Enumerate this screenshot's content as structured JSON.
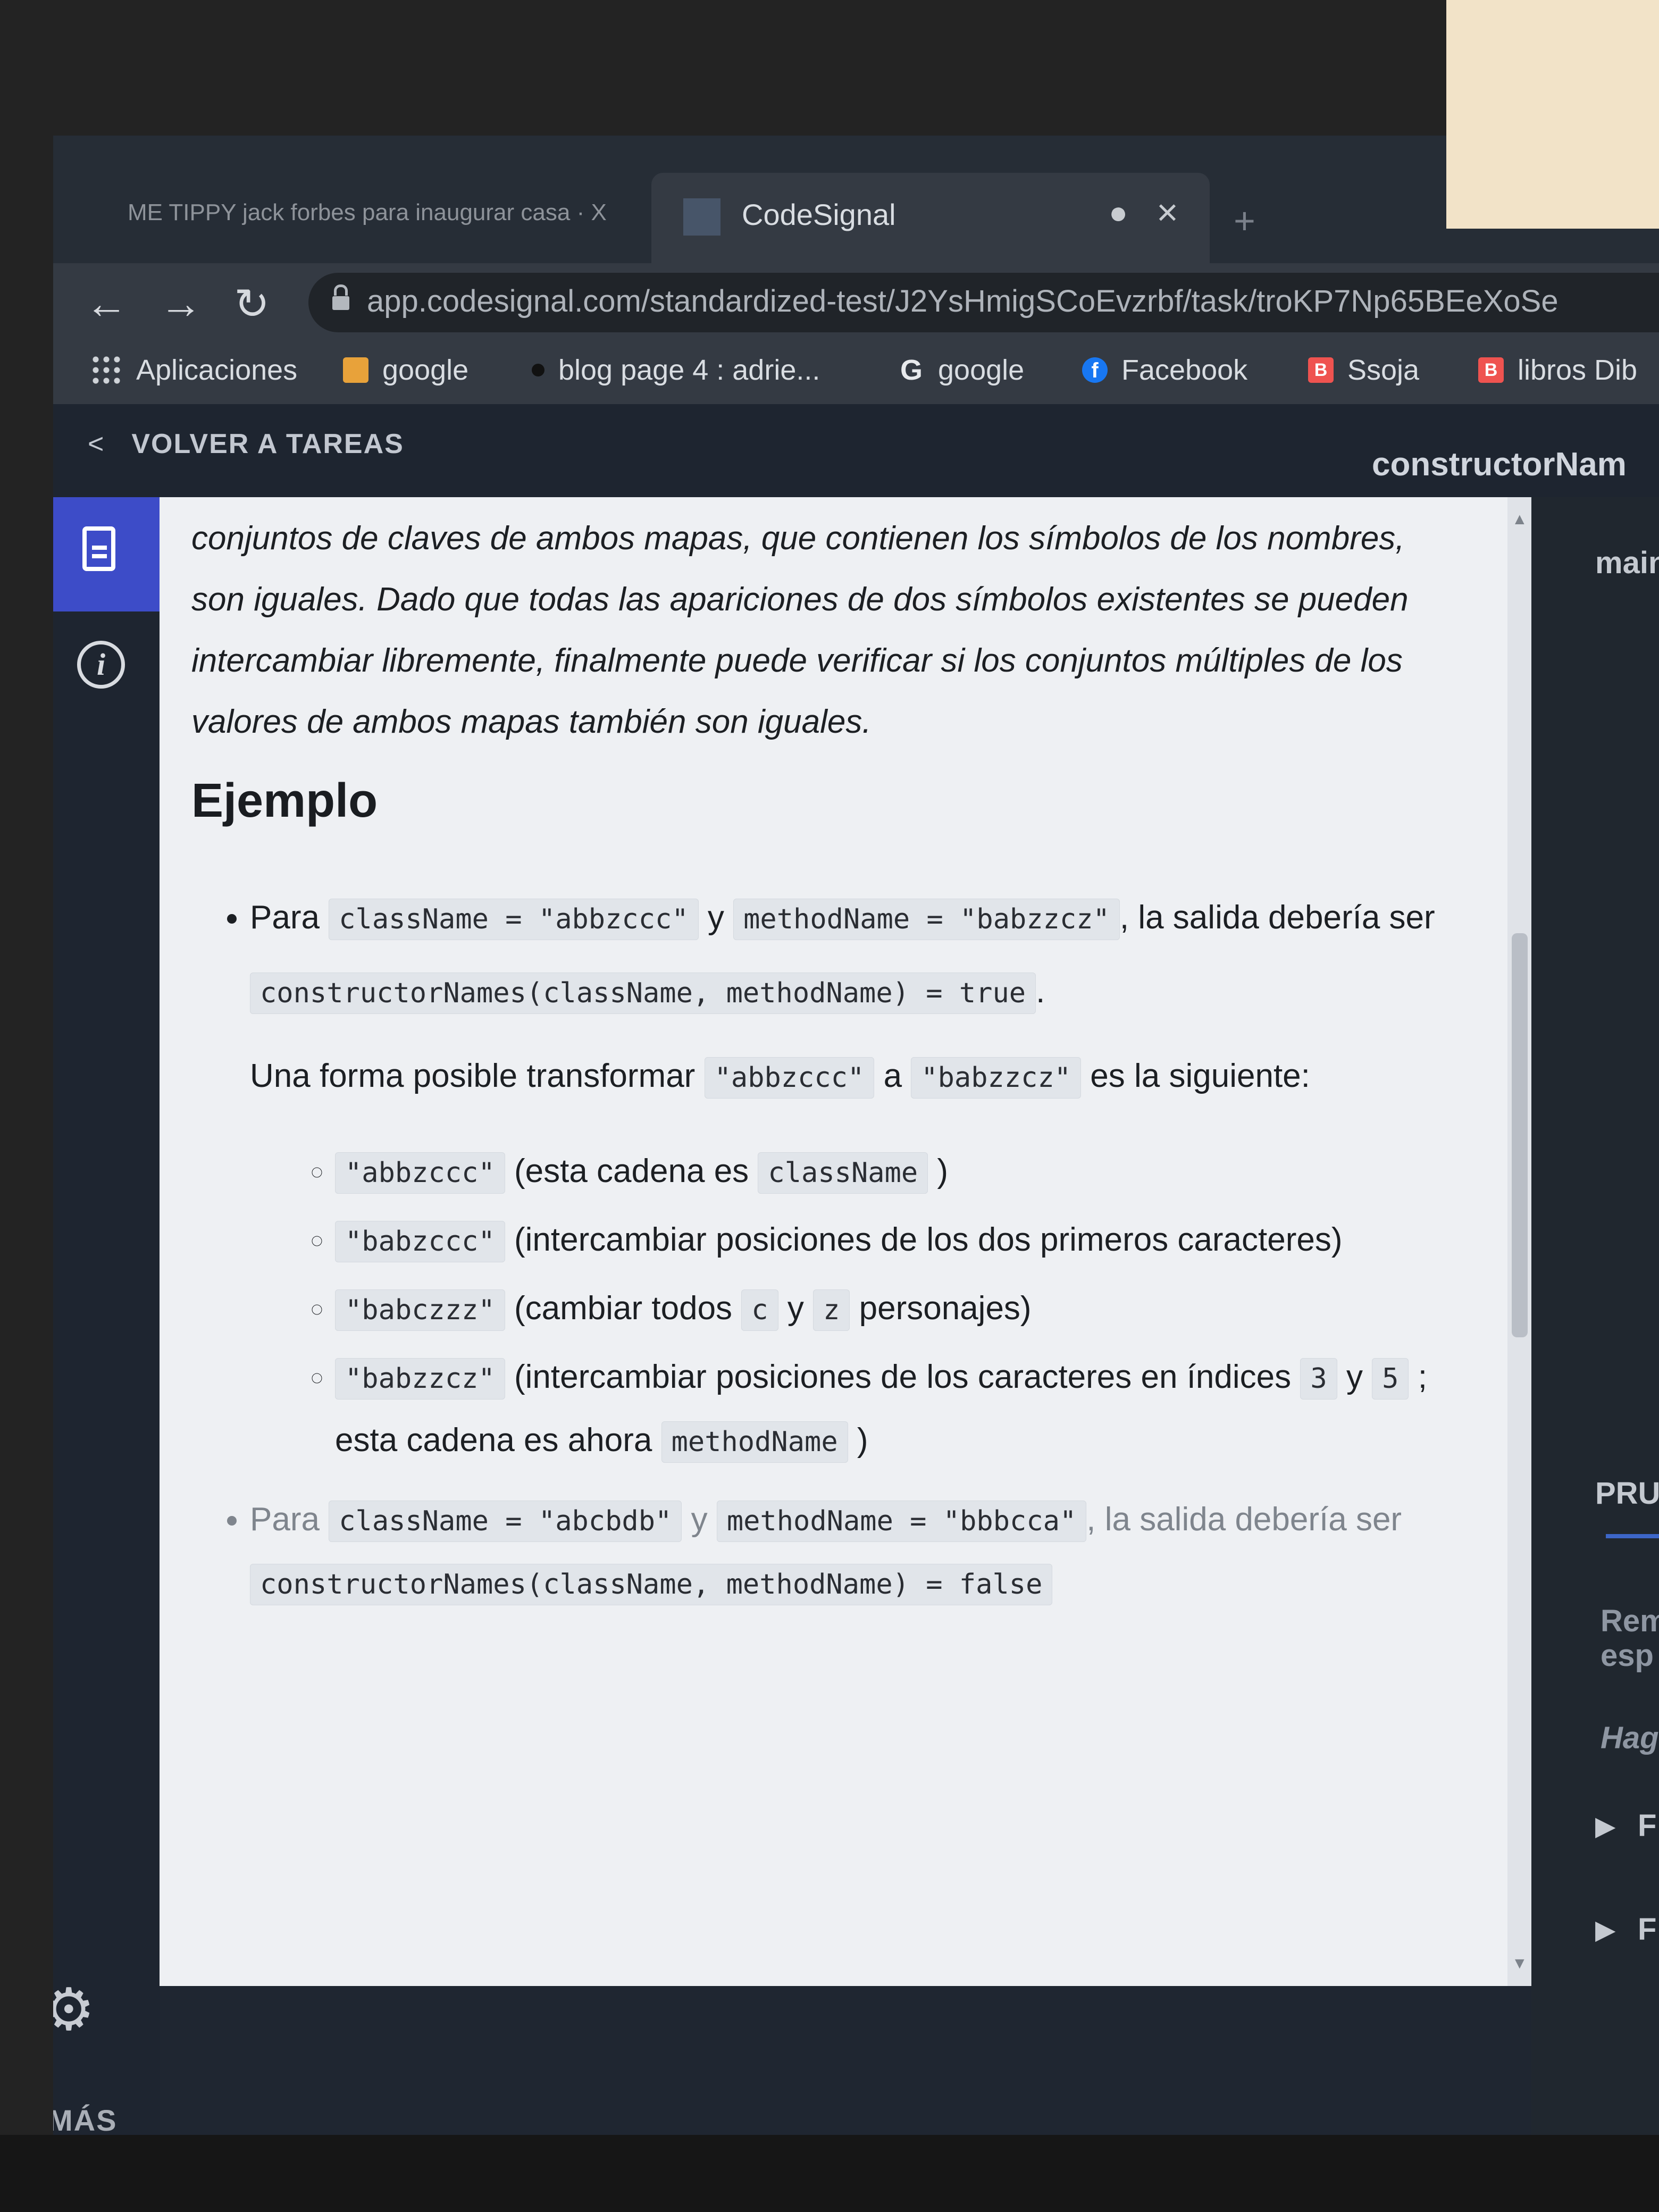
{
  "browser": {
    "tabs": [
      {
        "title": "ME TIPPY jack forbes para inaugurar casa · X"
      },
      {
        "title": "CodeSignal"
      }
    ],
    "url": "app.codesignal.com/standardized-test/J2YsHmigSCoEvzrbf/task/troKP7Np65BEeXoSe",
    "bookmarks": [
      {
        "label": "Aplicaciones",
        "icon": "apps-grid-icon",
        "color": "#cfd3d8"
      },
      {
        "label": "google",
        "icon": "bookmark-square-icon",
        "color": "#e8a23a"
      },
      {
        "label": "blog page 4 : adrie...",
        "icon": "dot-icon",
        "color": "#1a1a1a"
      },
      {
        "label": "google",
        "icon": "google-g-icon",
        "color": "#4285f4"
      },
      {
        "label": "Facebook",
        "icon": "facebook-icon",
        "color": "#1877f2"
      },
      {
        "label": "Ssoja",
        "icon": "blogger-icon",
        "color": "#ef5350"
      },
      {
        "label": "libros Dib",
        "icon": "blogger-icon",
        "color": "#ef5350"
      }
    ]
  },
  "app": {
    "back_label": "VOLVER A TAREAS",
    "task_name": "constructorNam",
    "more_label": "MÁS"
  },
  "content": {
    "intro": "conjuntos de claves de ambos mapas, que contienen los símbolos de los nombres, son iguales. Dado que todas las apariciones de dos símbolos existentes se pueden intercambiar libremente, finalmente puede verificar si los conjuntos múltiples de los valores de ambos mapas también son iguales.",
    "example_heading": "Ejemplo",
    "ex1": {
      "para": "Para",
      "code1": "className = \"abbzccc\"",
      "y": "y",
      "code2": "methodName = \"babzzcz\"",
      "salida": ", la salida",
      "deberia": "debería ser",
      "result_code": "constructorNames(className, methodName) = true",
      "dot": ".",
      "transform_pre": "Una forma posible transformar",
      "transform_code1": "\"abbzccc\"",
      "transform_a": "a",
      "transform_code2": "\"babzzcz\"",
      "transform_post": "es la siguiente:",
      "steps": [
        {
          "code": "\"abbzccc\"",
          "text": "(esta cadena es",
          "code2": "className",
          "end": ")"
        },
        {
          "code": "\"babzccc\"",
          "text": "(intercambiar posiciones de los dos primeros caracteres)"
        },
        {
          "code": "\"babczzz\"",
          "text": "(cambiar todos",
          "c": "c",
          "y": "y",
          "z": "z",
          "end": "personajes)"
        },
        {
          "code": "\"babzzcz\"",
          "text": "(intercambiar posiciones de los caracteres en índices",
          "n3": "3",
          "y": "y",
          "n5": "5",
          "mid": "; esta cadena es ahora",
          "code2": "methodName",
          "end": ")"
        }
      ]
    },
    "ex2": {
      "para": "Para",
      "code1": "className = \"abcbdb\"",
      "y": "y",
      "code2": "methodName = \"bbbcca\"",
      "salida": ", la salida",
      "deberia": "debería ser",
      "result_code": "constructorNames(className, methodName) = false"
    }
  },
  "right_panel": {
    "file_tab": "main.js",
    "tests_label": "PRUEB",
    "rem_line1": "Rem",
    "rem_line2": "esp",
    "hag": "Hag",
    "test1": "F",
    "test2": "F"
  }
}
